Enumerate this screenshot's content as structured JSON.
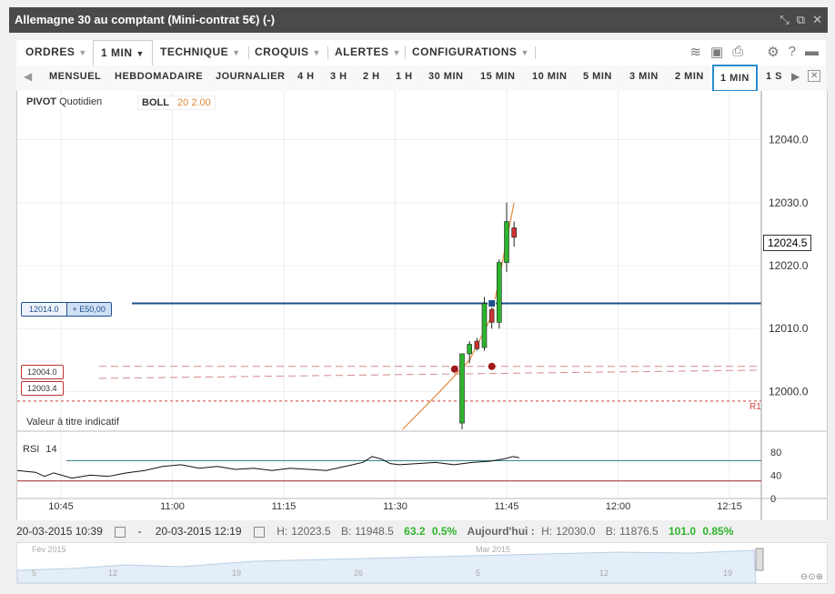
{
  "window": {
    "title": "Allemagne 30 au comptant (Mini-contrat 5€) (-)"
  },
  "menu": {
    "items": [
      "ORDRES",
      "1 MIN",
      "TECHNIQUE",
      "CROQUIS",
      "ALERTES",
      "CONFIGURATIONS"
    ]
  },
  "timeframes": [
    "MENSUEL",
    "HEBDOMADAIRE",
    "JOURNALIER",
    "4 H",
    "3 H",
    "2 H",
    "1 H",
    "30 MIN",
    "15 MIN",
    "10 MIN",
    "5 MIN",
    "3 MIN",
    "2 MIN",
    "1 MIN",
    "1 S"
  ],
  "indicators": {
    "pivot_label": "PIVOT",
    "pivot_value": "Quotidien",
    "boll_label": "BOLL",
    "boll_p1": "20",
    "boll_p2": "2.00",
    "rsi_label": "RSI",
    "rsi_period": "14"
  },
  "annotations": {
    "indicative": "Valeur à titre indicatif",
    "r1": "R1",
    "order_price": "12014.0",
    "order_pl": "+ E50,00",
    "level2": "12004.0",
    "level3": "12003.4",
    "current_price": "12024.5"
  },
  "status": {
    "from": "20-03-2015 10:39",
    "dash": "-",
    "to": "20-03-2015 12:19",
    "h_label": "H:",
    "h_value": "12023.5",
    "b_label": "B:",
    "b_value": "11948.5",
    "chg": "63.2",
    "chg_pct": "0.5%",
    "today_label": "Aujourd'hui :",
    "today_h": "12030.0",
    "today_b": "11876.5",
    "today_chg": "101.0",
    "today_pct": "0.85%"
  },
  "navigator": {
    "labels": [
      "Fév 2015",
      "Mar 2015"
    ],
    "days": [
      "5",
      "12",
      "19",
      "26",
      "5",
      "12",
      "19"
    ]
  },
  "colors": {
    "up": "#2db52d",
    "down": "#c83232",
    "price_line": "#1f4e8c",
    "boll": "#e08a3c",
    "pivot_dash": "#d48a8a",
    "r1": "#d04040"
  },
  "chart_data": {
    "type": "candlestick",
    "x_ticks": [
      "10:45",
      "11:00",
      "11:15",
      "11:30",
      "11:45",
      "12:00",
      "12:15"
    ],
    "y_ticks": [
      12000.0,
      12010.0,
      12020.0,
      12030.0,
      12040.0
    ],
    "ylim": [
      11994,
      12046
    ],
    "rsi_ticks": [
      80,
      40,
      0
    ],
    "candles": [
      {
        "t": "11:39",
        "o": 11995.0,
        "h": 12006.0,
        "l": 11988.0,
        "c": 12006.0,
        "dir": "up"
      },
      {
        "t": "11:40",
        "o": 12006.0,
        "h": 12008.0,
        "l": 12004.5,
        "c": 12007.5,
        "dir": "up"
      },
      {
        "t": "11:41",
        "o": 12008.0,
        "h": 12008.5,
        "l": 12006.5,
        "c": 12006.8,
        "dir": "down"
      },
      {
        "t": "11:42",
        "o": 12007.0,
        "h": 12015.0,
        "l": 12006.5,
        "c": 12014.0,
        "dir": "up"
      },
      {
        "t": "11:43",
        "o": 12013.0,
        "h": 12014.5,
        "l": 12010.0,
        "c": 12011.0,
        "dir": "down"
      },
      {
        "t": "11:44",
        "o": 12011.0,
        "h": 12021.0,
        "l": 12010.0,
        "c": 12020.5,
        "dir": "up"
      },
      {
        "t": "11:45",
        "o": 12020.5,
        "h": 12030.0,
        "l": 12019.0,
        "c": 12027.0,
        "dir": "up"
      },
      {
        "t": "11:46",
        "o": 12026.0,
        "h": 12027.0,
        "l": 12023.0,
        "c": 12024.5,
        "dir": "down"
      }
    ],
    "boll_mid": [
      {
        "t": "11:31",
        "y": 11994.0
      },
      {
        "t": "11:36",
        "y": 12000.0
      },
      {
        "t": "11:40",
        "y": 12005.0
      },
      {
        "t": "11:43",
        "y": 12012.0
      },
      {
        "t": "11:45",
        "y": 12024.0
      },
      {
        "t": "11:46",
        "y": 12030.0
      }
    ],
    "levels": {
      "order": 12014.0,
      "pivot_a": 12004.0,
      "pivot_b": 12003.4,
      "r1": 11998.5
    },
    "current": 12024.5
  }
}
